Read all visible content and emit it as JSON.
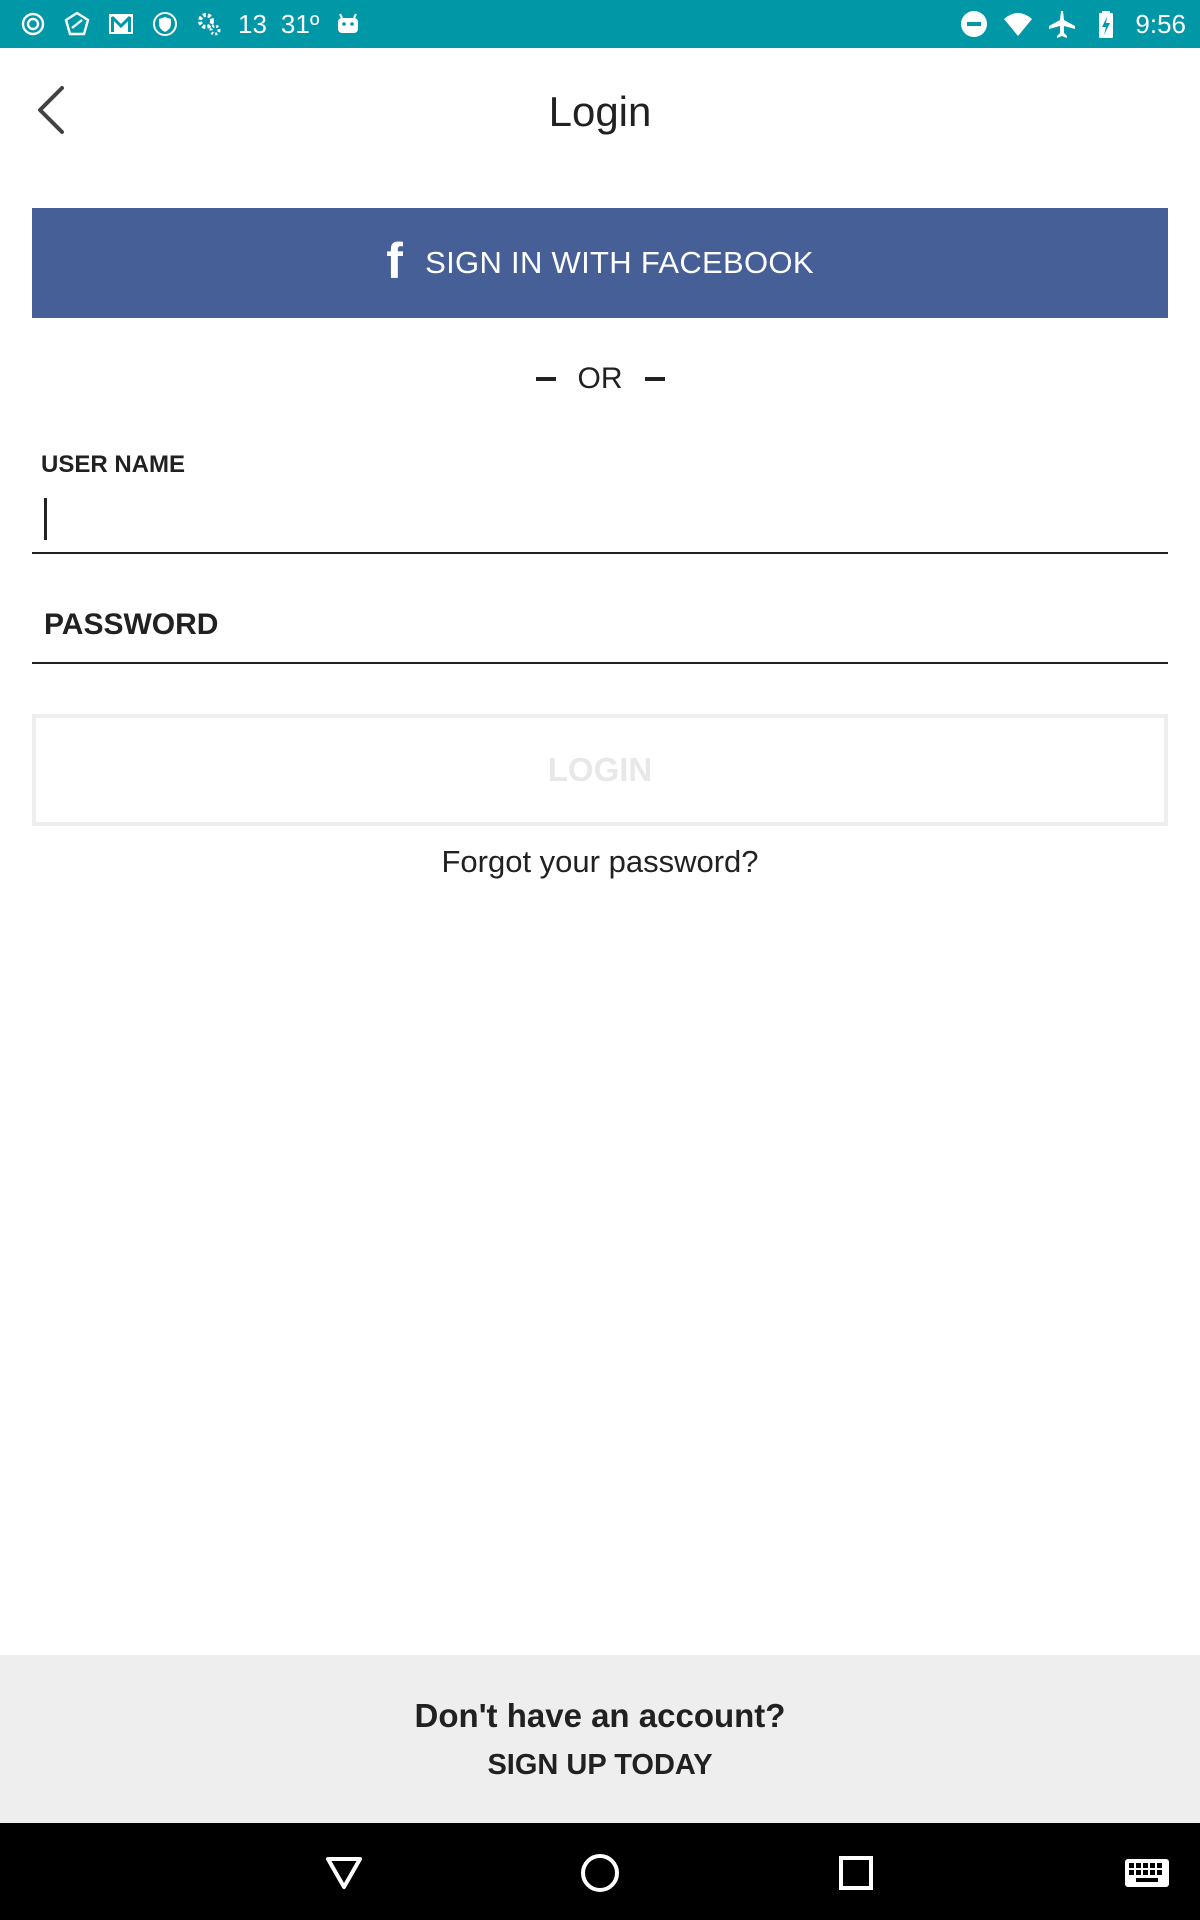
{
  "status_bar": {
    "notification_count": "13",
    "temperature": "31º",
    "time": "9:56",
    "background_color": "#0097a7",
    "left_icons": [
      "app-icon-1",
      "app-icon-2",
      "gmail-icon",
      "shield-icon",
      "settings-gear-icon",
      "android-icon"
    ],
    "right_icons": [
      "do-not-disturb-icon",
      "wifi-icon",
      "airplane-mode-icon",
      "battery-charging-icon"
    ]
  },
  "header": {
    "title": "Login",
    "back_icon": "chevron-left-icon"
  },
  "facebook_button": {
    "icon_glyph": "f",
    "label": "SIGN IN WITH FACEBOOK",
    "color": "#475f97"
  },
  "divider": {
    "label": "OR"
  },
  "form": {
    "username_label": "USER NAME",
    "username_value": "",
    "password_label": "PASSWORD",
    "password_value": "",
    "login_label": "LOGIN",
    "forgot_label": "Forgot your password?"
  },
  "footer": {
    "question": "Don't have an account?",
    "signup_label": "SIGN UP TODAY"
  },
  "nav_bar": {
    "buttons": [
      "back-triangle-icon",
      "home-circle-icon",
      "recents-square-icon",
      "keyboard-icon"
    ]
  }
}
